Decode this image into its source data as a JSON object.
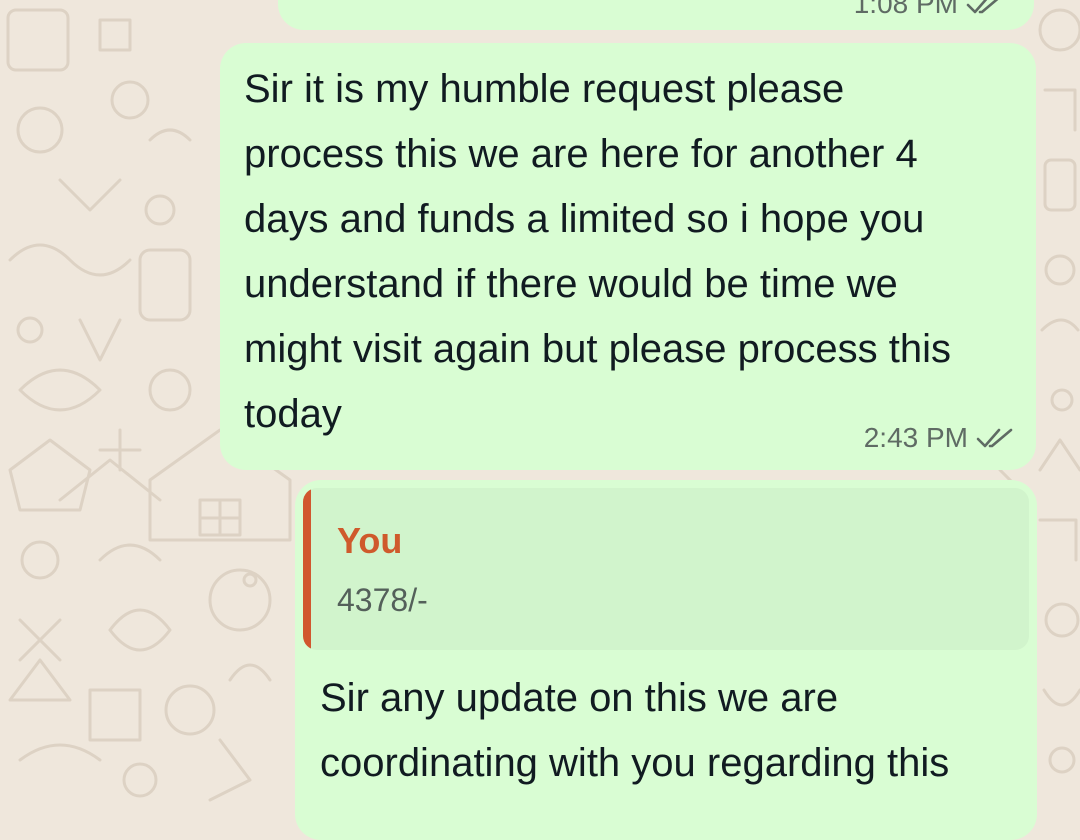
{
  "messages": [
    {
      "text": "",
      "time": "1:08 PM",
      "status_icon": "double-check-icon"
    },
    {
      "text": "Sir it is my humble request please\nprocess this we are here for another 4\ndays and funds a limited so i hope you\nunderstand if there would be time we\nmight visit again but please process this\ntoday",
      "time": "2:43 PM",
      "status_icon": "double-check-icon"
    },
    {
      "quoted": {
        "author": "You",
        "text": "4378/-"
      },
      "text": "Sir any update on this we are\ncoordinating with you regarding this"
    }
  ],
  "colors": {
    "chat_background": "#efe7dc",
    "outgoing_bubble": "#d9fdd3",
    "quote_background": "#d1f4cc",
    "quote_accent": "#d1572e",
    "meta_text": "#5f6b64"
  }
}
